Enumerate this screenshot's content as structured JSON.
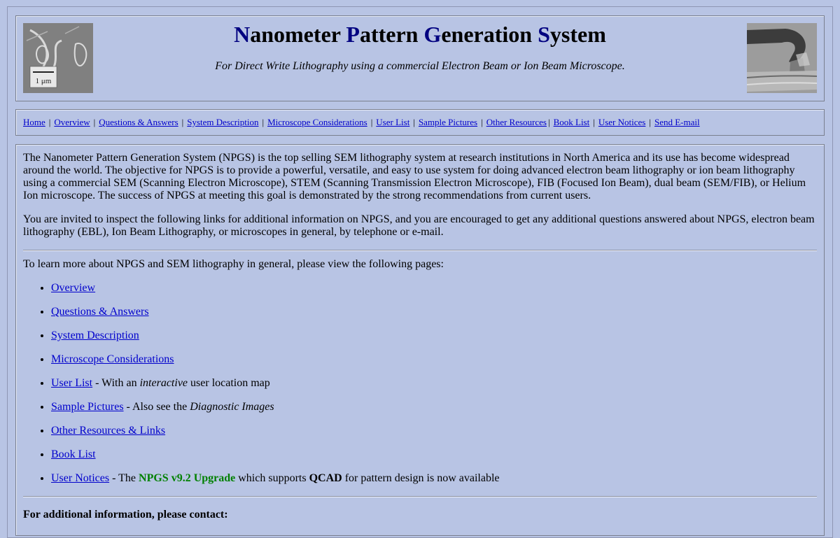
{
  "header": {
    "title_parts": [
      {
        "cap": "N",
        "rest": "anometer "
      },
      {
        "cap": "P",
        "rest": "attern "
      },
      {
        "cap": "G",
        "rest": "eneration "
      },
      {
        "cap": "S",
        "rest": "ystem"
      }
    ],
    "subtitle": "For Direct Write Lithography using a commercial Electron Beam or Ion Beam Microscope.",
    "scale_label": "1 μm"
  },
  "nav": {
    "items": [
      "Home",
      "Overview",
      "Questions & Answers",
      "System Description",
      "Microscope Considerations",
      "User List",
      "Sample Pictures",
      "Other Resources",
      "Book List",
      "User Notices",
      "Send E-mail"
    ],
    "separator": "|"
  },
  "main": {
    "intro": "The Nanometer Pattern Generation System (NPGS) is the top selling SEM lithography system at research institutions in North America and its use has become widespread around the world. The objective for NPGS is to provide a powerful, versatile, and easy to use system for doing advanced electron  beam lithography or ion beam lithography using a commercial SEM (Scanning Electron Microscope), STEM (Scanning Transmission Electron Microscope), FIB (Focused Ion Beam), dual beam (SEM/FIB), or Helium Ion microscope. The success of NPGS at meeting this goal is demonstrated by the strong recommendations from current users.",
    "invite": "You are invited to inspect the following links for additional information on NPGS, and you are encouraged to get any additional questions answered about NPGS, electron beam lithography (EBL), Ion Beam Lithography, or microscopes in general, by telephone or e-mail.",
    "learn_more": "To learn more about NPGS and SEM lithography in general, please view the following pages:",
    "links": {
      "overview": "Overview",
      "qa": "Questions & Answers",
      "system_description": "System Description",
      "microscope": "Microscope Considerations",
      "user_list": "User List",
      "user_list_pre": " - With an ",
      "user_list_em": "interactive",
      "user_list_post": " user location map",
      "sample_pictures": "Sample Pictures",
      "sample_pre": " - Also see the ",
      "sample_em": "Diagnostic Images",
      "other_resources": "Other Resources & Links",
      "book_list": "Book List",
      "user_notices": "User Notices",
      "notices_pre": " - The ",
      "notices_upgrade": "NPGS v9.2 Upgrade",
      "notices_mid": " which supports ",
      "notices_qcad": "QCAD",
      "notices_post": " for pattern design is now available"
    },
    "contact_heading": "For additional information, please contact:"
  },
  "colors": {
    "background": "#b8c4e4",
    "link": "#0000cc",
    "title_caps": "#000080",
    "upgrade": "#008000"
  }
}
